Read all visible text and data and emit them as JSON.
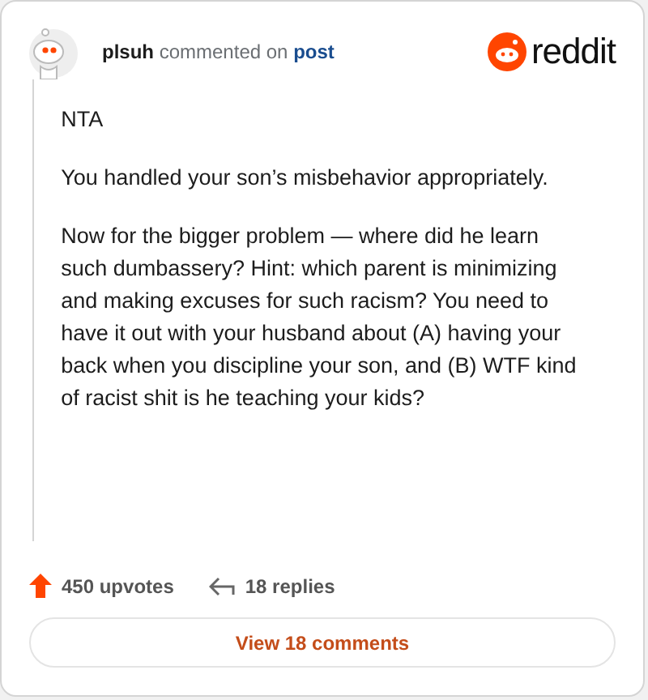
{
  "header": {
    "username": "plsuh",
    "action": "commented on",
    "link": "post",
    "brand": "reddit"
  },
  "paragraphs": [
    "NTA",
    "You handled your son’s misbehavior appropriately.",
    "Now for the bigger problem — where did he learn such dumbassery? Hint: which parent is minimizing and making excuses for such racism? You need to have it out with your husband about (A) having your back when you discipline your son, and (B) WTF kind of racist shit is he teaching your kids?"
  ],
  "footer": {
    "upvotes": "450 upvotes",
    "replies": "18 replies"
  },
  "button": "View 18 comments"
}
